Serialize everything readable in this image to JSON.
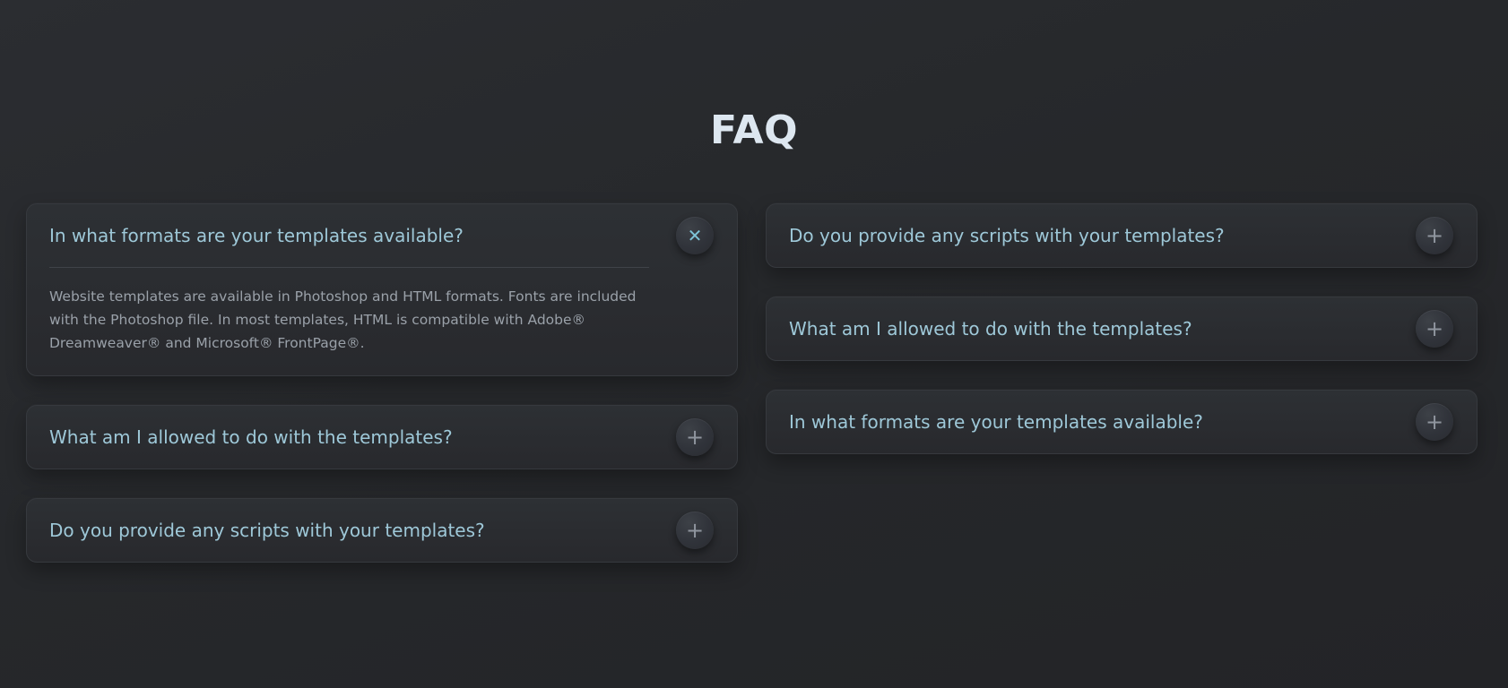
{
  "page": {
    "title": "FAQ"
  },
  "faq": {
    "left": [
      {
        "question": "In what formats are your templates available?",
        "expanded": true,
        "toggle_icon": "✕",
        "answer": "Website templates are available in Photoshop and HTML formats. Fonts are included with the Photoshop file. In most templates, HTML is compatible with Adobe® Dreamweaver® and Microsoft® FrontPage®."
      },
      {
        "question": "What am I allowed to do with the templates?",
        "expanded": false,
        "toggle_icon": "+"
      },
      {
        "question": "Do you provide any scripts with your templates?",
        "expanded": false,
        "toggle_icon": "+"
      }
    ],
    "right": [
      {
        "question": "Do you provide any scripts with your templates?",
        "expanded": false,
        "toggle_icon": "+"
      },
      {
        "question": "What am I allowed to do with the templates?",
        "expanded": false,
        "toggle_icon": "+"
      },
      {
        "question": "In what formats are your templates available?",
        "expanded": false,
        "toggle_icon": "+"
      }
    ]
  },
  "colors": {
    "background": "#26282b",
    "card": "#2b2d31",
    "title": "#dde7f0",
    "question": "#9ec8d8",
    "answer": "#9aa1a9",
    "close_icon": "#7ec3d6",
    "plus_icon": "#8f959e"
  },
  "icons": {
    "open_toggle": "close-icon",
    "closed_toggle": "plus-icon"
  }
}
